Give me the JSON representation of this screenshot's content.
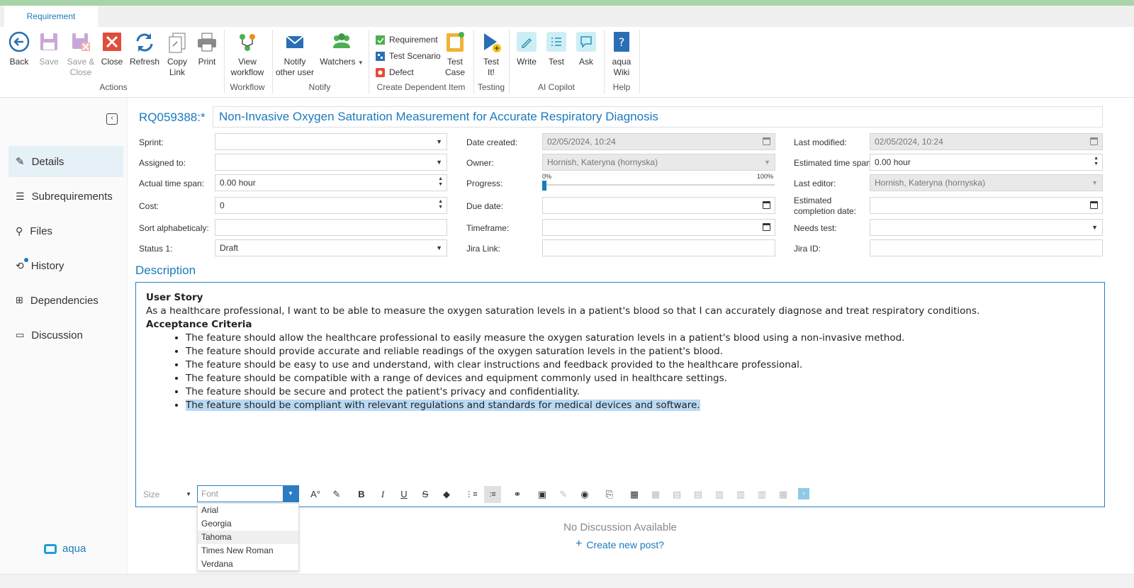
{
  "tab": {
    "label": "Requirement"
  },
  "ribbon": {
    "back": "Back",
    "save": "Save",
    "save_close_1": "Save &",
    "save_close_2": "Close",
    "close": "Close",
    "refresh": "Refresh",
    "copy_link_1": "Copy",
    "copy_link_2": "Link",
    "print": "Print",
    "view_workflow_1": "View",
    "view_workflow_2": "workflow",
    "notify_other_1": "Notify",
    "notify_other_2": "other user",
    "watchers": "Watchers",
    "dep_requirement": "Requirement",
    "dep_test_scenario": "Test Scenario",
    "dep_defect": "Defect",
    "test_case_1": "Test",
    "test_case_2": "Case",
    "test_it_1": "Test",
    "test_it_2": "It!",
    "write": "Write",
    "test": "Test",
    "ask": "Ask",
    "aqua_wiki_1": "aqua",
    "aqua_wiki_2": "Wiki",
    "groups": {
      "actions": "Actions",
      "workflow": "Workflow",
      "notify": "Notify",
      "create_dependent": "Create Dependent Item",
      "testing": "Testing",
      "ai_copilot": "AI Copilot",
      "help": "Help"
    }
  },
  "sidebar": {
    "items": [
      {
        "label": "Details"
      },
      {
        "label": "Subrequirements"
      },
      {
        "label": "Files"
      },
      {
        "label": "History"
      },
      {
        "label": "Dependencies"
      },
      {
        "label": "Discussion"
      }
    ],
    "brand": "aqua"
  },
  "header": {
    "id": "RQ059388:*",
    "title": "Non-Invasive Oxygen Saturation Measurement for Accurate Respiratory Diagnosis"
  },
  "fields": {
    "sprint_label": "Sprint:",
    "sprint_value": "",
    "assigned_label": "Assigned to:",
    "assigned_value": "",
    "actual_label": "Actual time span:",
    "actual_value": "0.00 hour",
    "cost_label": "Cost:",
    "cost_value": "0",
    "sort_label": "Sort alphabeticaly:",
    "sort_value": "",
    "status_label": "Status 1:",
    "status_value": "Draft",
    "date_created_label": "Date created:",
    "date_created_value": "02/05/2024, 10:24",
    "owner_label": "Owner:",
    "owner_value": "Hornish, Kateryna (hornyska)",
    "progress_label": "Progress:",
    "progress_min": "0%",
    "progress_max": "100%",
    "progress_value": 0,
    "due_label": "Due date:",
    "timeframe_label": "Timeframe:",
    "jira_link_label": "Jira Link:",
    "last_modified_label": "Last modified:",
    "last_modified_value": "02/05/2024, 10:24",
    "est_span_label": "Estimated time span:",
    "est_span_value": "0.00 hour",
    "last_editor_label": "Last editor:",
    "last_editor_value": "Hornish, Kateryna (hornyska)",
    "est_completion_label_1": "Estimated",
    "est_completion_label_2": "completion date:",
    "needs_test_label": "Needs test:",
    "jira_id_label": "Jira ID:"
  },
  "description": {
    "heading": "Description",
    "user_story_title": "User Story",
    "user_story": "As a healthcare professional, I want to be able to measure the oxygen saturation levels in a patient's blood so that I can accurately diagnose and treat respiratory conditions.",
    "acceptance_title": "Acceptance Criteria",
    "criteria": [
      "The feature should allow the healthcare professional to easily measure the oxygen saturation levels in a patient's blood using a non-invasive method.",
      "The feature should provide accurate and reliable readings of the oxygen saturation levels in the patient's blood.",
      "The feature should be easy to use and understand, with clear instructions and feedback provided to the healthcare professional.",
      "The feature should be compatible with a range of devices and equipment commonly used in healthcare settings.",
      "The feature should be secure and protect the patient's privacy and confidentiality.",
      "The feature should be compliant with relevant regulations and standards for medical devices and software."
    ]
  },
  "editor": {
    "size_placeholder": "Size",
    "font_placeholder": "Font",
    "font_options": [
      "Arial",
      "Georgia",
      "Tahoma",
      "Times New Roman",
      "Verdana"
    ]
  },
  "discussion": {
    "empty": "No Discussion Available",
    "create": "Create new post?"
  },
  "colors": {
    "accent": "#1a7bbd",
    "topbar": "#a9d3a9",
    "highlight": "#b9d9f4"
  }
}
